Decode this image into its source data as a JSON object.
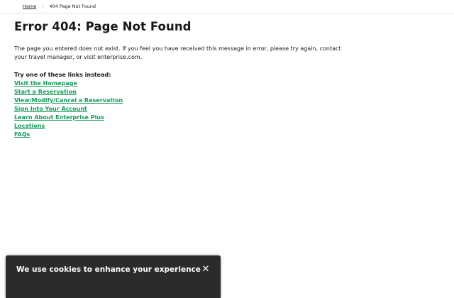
{
  "breadcrumb": {
    "home": "Home",
    "separator": "/",
    "current": "404 Page Not Found"
  },
  "main": {
    "title": "Error 404: Page Not Found",
    "description": "The page you entered does not exist. If you feel you have received this message in error, please try again, contact your travel manager, or visit enterprise.com.",
    "links_heading": "Try one of these links instead:",
    "links": [
      {
        "label": "Visit the Homepage"
      },
      {
        "label": "Start a Reservation"
      },
      {
        "label": "View/Modify/Cancel a Reservation"
      },
      {
        "label": "Sign Into Your Account"
      },
      {
        "label": "Learn About Enterprise Plus"
      },
      {
        "label": "Locations"
      },
      {
        "label": "FAQs"
      }
    ]
  },
  "cookie_banner": {
    "title": "We use cookies to enhance your experience",
    "close_symbol": "✕"
  },
  "colors": {
    "link": "#169a5a",
    "banner_bg": "#2b2b2b",
    "text": "#181818"
  }
}
